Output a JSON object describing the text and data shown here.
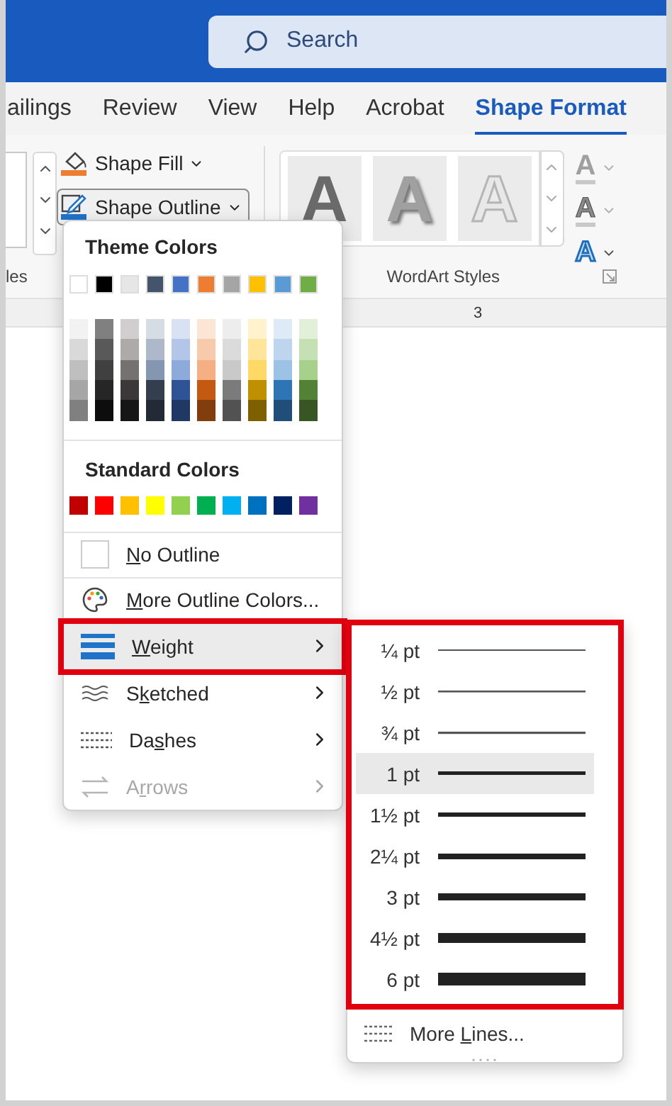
{
  "search": {
    "placeholder": "Search"
  },
  "tabs": [
    {
      "label": "ailings",
      "selected": false
    },
    {
      "label": "Review",
      "selected": false
    },
    {
      "label": "View",
      "selected": false
    },
    {
      "label": "Help",
      "selected": false
    },
    {
      "label": "Acrobat",
      "selected": false
    },
    {
      "label": "Shape Format",
      "selected": true
    }
  ],
  "ribbon": {
    "left_group_label": "les",
    "shape_fill": {
      "label": "Shape Fill",
      "pressed": false
    },
    "shape_outline": {
      "label": "Shape Outline",
      "pressed": true
    },
    "wordart_styles": [
      {
        "text": "A",
        "kind": "dark"
      },
      {
        "text": "A",
        "kind": "shadow"
      },
      {
        "text": "A",
        "kind": "outline"
      }
    ],
    "text_tools": [
      {
        "text": "A",
        "kind": "fill",
        "disabled": true
      },
      {
        "text": "A",
        "kind": "outline",
        "disabled": true
      },
      {
        "text": "A",
        "kind": "effects",
        "disabled": false
      }
    ],
    "wordart_label": "WordArt Styles"
  },
  "ruler": {
    "label": "3"
  },
  "menu": {
    "theme_title": "Theme Colors",
    "theme_colors": [
      {
        "color": "#ffffff",
        "shades": [
          {
            "color": "#f2f2f2"
          },
          {
            "color": "#d9d9d9"
          },
          {
            "color": "#bfbfbf"
          },
          {
            "color": "#a6a6a6"
          },
          {
            "color": "#808080"
          }
        ]
      },
      {
        "color": "#000000",
        "shades": [
          {
            "color": "#808080"
          },
          {
            "color": "#595959"
          },
          {
            "color": "#404040"
          },
          {
            "color": "#262626"
          },
          {
            "color": "#0d0d0d"
          }
        ]
      },
      {
        "color": "#e7e6e6",
        "shades": [
          {
            "color": "#d0cece"
          },
          {
            "color": "#aeaaaa"
          },
          {
            "color": "#757171"
          },
          {
            "color": "#3a3838"
          },
          {
            "color": "#171616"
          }
        ]
      },
      {
        "color": "#44546a",
        "shades": [
          {
            "color": "#d6dce4"
          },
          {
            "color": "#adb9ca"
          },
          {
            "color": "#8496b0"
          },
          {
            "color": "#333f4f"
          },
          {
            "color": "#222a35"
          }
        ]
      },
      {
        "color": "#4472c4",
        "shades": [
          {
            "color": "#d9e2f3"
          },
          {
            "color": "#b4c6e7"
          },
          {
            "color": "#8eaadb"
          },
          {
            "color": "#2f5496"
          },
          {
            "color": "#1f3864"
          }
        ]
      },
      {
        "color": "#ed7d31",
        "shades": [
          {
            "color": "#fbe5d5"
          },
          {
            "color": "#f7caac"
          },
          {
            "color": "#f4b083"
          },
          {
            "color": "#c45911"
          },
          {
            "color": "#833c0b"
          }
        ]
      },
      {
        "color": "#a5a5a5",
        "shades": [
          {
            "color": "#ededed"
          },
          {
            "color": "#dbdbdb"
          },
          {
            "color": "#c9c9c9"
          },
          {
            "color": "#7b7b7b"
          },
          {
            "color": "#525252"
          }
        ]
      },
      {
        "color": "#ffc000",
        "shades": [
          {
            "color": "#fff2cc"
          },
          {
            "color": "#ffe599"
          },
          {
            "color": "#ffd966"
          },
          {
            "color": "#bf9000"
          },
          {
            "color": "#7f6000"
          }
        ]
      },
      {
        "color": "#5b9bd5",
        "shades": [
          {
            "color": "#deeaf6"
          },
          {
            "color": "#bdd6ee"
          },
          {
            "color": "#9cc3e5"
          },
          {
            "color": "#2e75b5"
          },
          {
            "color": "#1f4e79"
          }
        ]
      },
      {
        "color": "#70ad47",
        "shades": [
          {
            "color": "#e2efd9"
          },
          {
            "color": "#c5e0b3"
          },
          {
            "color": "#a8d08d"
          },
          {
            "color": "#538135"
          },
          {
            "color": "#375623"
          }
        ]
      }
    ],
    "standard_title": "Standard Colors",
    "standard_colors": [
      {
        "color": "#c00000"
      },
      {
        "color": "#ff0000"
      },
      {
        "color": "#ffc000"
      },
      {
        "color": "#ffff00"
      },
      {
        "color": "#92d050"
      },
      {
        "color": "#00b050"
      },
      {
        "color": "#00b0f0"
      },
      {
        "color": "#0070c0"
      },
      {
        "color": "#002060"
      },
      {
        "color": "#7030a0"
      }
    ],
    "items": [
      {
        "kind": "none",
        "label": {
          "key": "N",
          "after": "o Outline"
        },
        "selected": false,
        "submenu": false,
        "disabled": false,
        "highlighted": false
      },
      {
        "kind": "palette",
        "label": {
          "key": "M",
          "after": "ore Outline Colors..."
        },
        "selected": false,
        "submenu": false,
        "disabled": false,
        "highlighted": false
      },
      {
        "kind": "weight",
        "label": {
          "key": "W",
          "after": "eight"
        },
        "selected": true,
        "submenu": true,
        "disabled": false,
        "highlighted": true
      },
      {
        "kind": "sketched",
        "label": {
          "before": "S",
          "key": "k",
          "after": "etched"
        },
        "selected": false,
        "submenu": true,
        "disabled": false,
        "highlighted": false
      },
      {
        "kind": "dashes",
        "label": {
          "before": "Da",
          "key": "s",
          "after": "hes"
        },
        "selected": false,
        "submenu": true,
        "disabled": false,
        "highlighted": false
      },
      {
        "kind": "arrows",
        "label": {
          "before": "A",
          "key": "r",
          "after": "rows"
        },
        "selected": false,
        "submenu": true,
        "disabled": true,
        "highlighted": false
      }
    ]
  },
  "weight_menu": {
    "highlighted": true,
    "items": [
      {
        "label": "¼ pt",
        "kind": "quarter",
        "selected": false
      },
      {
        "label": "½ pt",
        "kind": "half",
        "selected": false
      },
      {
        "label": "¾ pt",
        "kind": "threequarter",
        "selected": false
      },
      {
        "label": "1 pt",
        "kind": "one",
        "selected": true
      },
      {
        "label": "1½ pt",
        "kind": "onehalf",
        "selected": false
      },
      {
        "label": "2¼ pt",
        "kind": "twoquarter",
        "selected": false
      },
      {
        "label": "3 pt",
        "kind": "three",
        "selected": false
      },
      {
        "label": "4½ pt",
        "kind": "fourhalf",
        "selected": false
      },
      {
        "label": "6 pt",
        "kind": "six",
        "selected": false
      }
    ],
    "more_lines": {
      "before": "More ",
      "key": "L",
      "after": "ines..."
    }
  }
}
